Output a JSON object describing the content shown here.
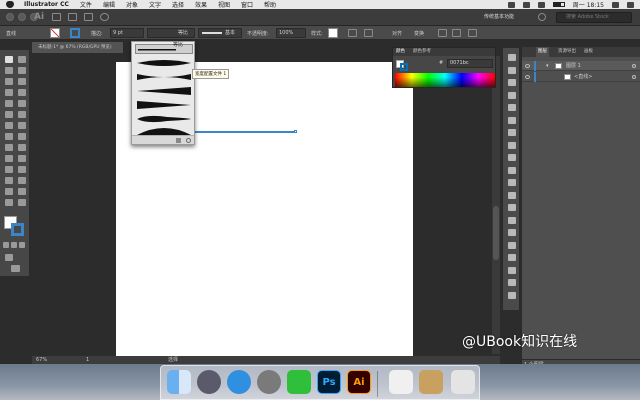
{
  "menubar": {
    "app_name": "Illustrator CC",
    "items": [
      "文件",
      "编辑",
      "对象",
      "文字",
      "选择",
      "效果",
      "视图",
      "窗口",
      "帮助"
    ],
    "clock": "周一 18:15"
  },
  "appbar": {
    "logo": "Ai",
    "workspace": "传统基本功能",
    "search_placeholder": "搜索 Adobe Stock"
  },
  "ctrlbar": {
    "selection_label": "直线",
    "stroke_label": "描边:",
    "stroke_value": "9 pt",
    "profile_value": "等比",
    "brush_value": "基本",
    "opacity_label": "不透明度:",
    "opacity_value": "100%",
    "style_label": "样式:",
    "align_label": "对齐",
    "transform_label": "变换"
  },
  "document": {
    "tab_title": "未标题-1* @ 67% (RGB/GPU 预览)"
  },
  "width_profile": {
    "selected_label": "等比",
    "tooltip": "宽度配置文件 1"
  },
  "color_panel": {
    "tabs": [
      "颜色",
      "颜色参考"
    ],
    "hex_value": "0071bc",
    "hex_prefix": "#"
  },
  "layers_panel": {
    "tabs": [
      "图层",
      "资源导出",
      "画板"
    ],
    "layer_name": "图层 1",
    "sublayer_name": "<直线>",
    "footer": "1 个图层"
  },
  "statusbar": {
    "zoom": "67%",
    "page": "1",
    "tool": "选择"
  },
  "dock": {
    "ps_label": "Ps",
    "ai_label": "Ai"
  },
  "watermark": "@UBook知识在线",
  "colors": {
    "path_blue": "#3a86c8",
    "ps_blue": "#31a8ff",
    "ai_orange": "#ff9a00"
  }
}
